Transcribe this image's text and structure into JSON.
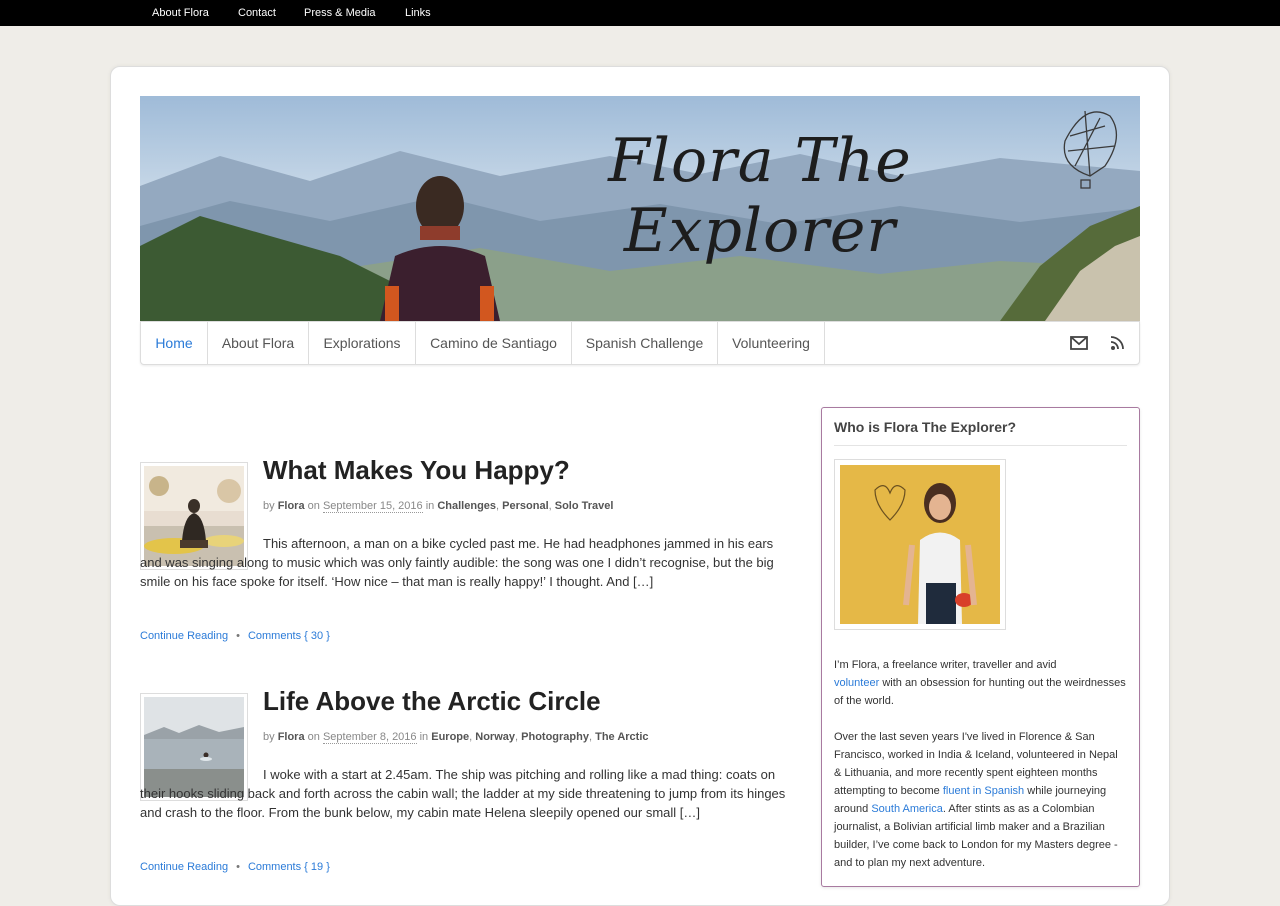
{
  "topnav": [
    "About Flora",
    "Contact",
    "Press & Media",
    "Links"
  ],
  "site": {
    "title": "Flora The Explorer"
  },
  "mainnav": {
    "items": [
      "Home",
      "About Flora",
      "Explorations",
      "Camino de Santiago",
      "Spanish Challenge",
      "Volunteering"
    ],
    "icons": [
      "mail-icon",
      "rss-icon"
    ]
  },
  "posts": [
    {
      "title": "What Makes You Happy?",
      "by": "by",
      "author": "Flora",
      "on": "on",
      "date": "September 15, 2016",
      "in": "in",
      "categories": [
        "Challenges",
        "Personal",
        "Solo Travel"
      ],
      "excerpt": "This afternoon, a man on a bike cycled past me. He had headphones jammed in his ears and was singing along to music which was only faintly audible: the song was one I didn’t recognise, but the big smile on his face spoke for itself. ‘How nice – that man is really happy!’ I thought. And […]",
      "continue": "Continue Reading",
      "separator": "•",
      "comments": "Comments { 30 }"
    },
    {
      "title": "Life Above the Arctic Circle",
      "by": "by",
      "author": "Flora",
      "on": "on",
      "date": "September 8, 2016",
      "in": "in",
      "categories": [
        "Europe",
        "Norway",
        "Photography",
        "The Arctic"
      ],
      "excerpt": "I woke with a start at 2.45am. The ship was pitching and rolling like a mad thing: coats on their hooks sliding back and forth across the cabin wall; the ladder at my side threatening to jump from its hinges and crash to the floor. From the bunk below, my cabin mate Helena sleepily opened our small […]",
      "continue": "Continue Reading",
      "separator": "•",
      "comments": "Comments { 19 }"
    }
  ],
  "sidebar": {
    "title": "Who is Flora The Explorer?",
    "p1_a": "I’m Flora, a freelance writer, traveller and avid",
    "p1_link": "volunteer",
    "p1_b": " with an obsession for hunting out the weirdnesses of the world.",
    "p2_a": "Over the last seven years I've lived in Florence & San Francisco, worked in India & Iceland, volunteered in Nepal & Lithuania, and more recently spent eighteen months attempting to become ",
    "p2_link1": "fluent in Spanish",
    "p2_b": " while journeying around ",
    "p2_link2": "South America",
    "p2_c": ". After stints as as a Colombian journalist, a Bolivian artificial limb maker and a Brazilian builder, I’ve come back to London for my Masters degree - and to plan my next adventure."
  },
  "colors": {
    "link": "#2b7bd8",
    "topbar": "#000000",
    "page_bg": "#efede8",
    "sidebar_border": "#a87aa0"
  }
}
